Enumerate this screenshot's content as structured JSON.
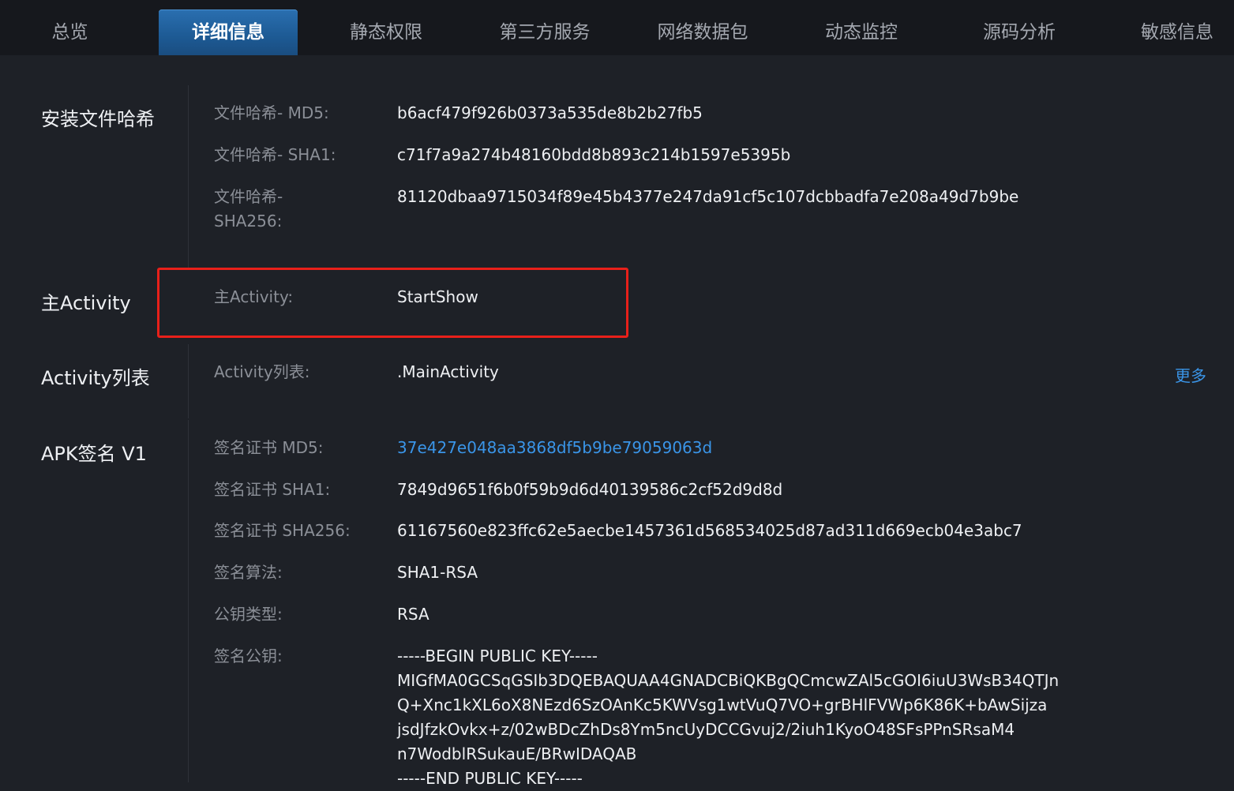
{
  "tabs": [
    {
      "label": "总览"
    },
    {
      "label": "详细信息"
    },
    {
      "label": "静态权限"
    },
    {
      "label": "第三方服务"
    },
    {
      "label": "网络数据包"
    },
    {
      "label": "动态监控"
    },
    {
      "label": "源码分析"
    },
    {
      "label": "敏感信息"
    }
  ],
  "active_tab": "详细信息",
  "sections": {
    "install_hash": {
      "title": "安装文件哈希",
      "md5_label": "文件哈希- MD5:",
      "md5_value": "b6acf479f926b0373a535de8b2b27fb5",
      "sha1_label": "文件哈希- SHA1:",
      "sha1_value": "c71f7a9a274b48160bdd8b893c214b1597e5395b",
      "sha256_label_line1": "文件哈希-",
      "sha256_label_line2": "SHA256:",
      "sha256_value": "81120dbaa9715034f89e45b4377e247da91cf5c107dcbbadfa7e208a49d7b9be"
    },
    "main_activity": {
      "title": "主Activity",
      "label": "主Activity:",
      "value": "StartShow"
    },
    "activity_list": {
      "title": "Activity列表",
      "label": "Activity列表:",
      "value": ".MainActivity",
      "more_label": "更多"
    },
    "apk_signature": {
      "title": "APK签名 V1",
      "cert_md5_label": "签名证书 MD5:",
      "cert_md5_value": "37e427e048aa3868df5b9be79059063d",
      "cert_sha1_label": "签名证书 SHA1:",
      "cert_sha1_value": "7849d9651f6b0f59b9d6d40139586c2cf52d9d8d",
      "cert_sha256_label": "签名证书 SHA256:",
      "cert_sha256_value": "61167560e823ffc62e5aecbe1457361d568534025d87ad311d669ecb04e3abc7",
      "algorithm_label": "签名算法:",
      "algorithm_value": "SHA1-RSA",
      "key_type_label": "公钥类型:",
      "key_type_value": "RSA",
      "public_key_label": "签名公钥:",
      "public_key_lines": [
        "-----BEGIN PUBLIC KEY-----",
        "MIGfMA0GCSqGSIb3DQEBAQUAA4GNADCBiQKBgQCmcwZAl5cGOI6iuU3WsB34QTJn",
        "Q+Xnc1kXL6oX8NEzd6SzOAnKc5KWVsg1wtVuQ7VO+grBHlFVWp6K86K+bAwSijza",
        "jsdJfzkOvkx+z/02wBDcZhDs8Ym5ncUyDCCGvuj2/2iuh1KyoO48SFsPPnSRsaM4",
        "n7WodblRSukauE/BRwIDAQAB",
        "-----END PUBLIC KEY-----"
      ]
    }
  },
  "colors": {
    "background": "#1e2127",
    "tabbar": "#16181d",
    "active_tab": "#1d5a94",
    "label": "#8b8f97",
    "value": "#eef0f3",
    "link": "#3a95e8",
    "highlight": "#e8201a"
  }
}
